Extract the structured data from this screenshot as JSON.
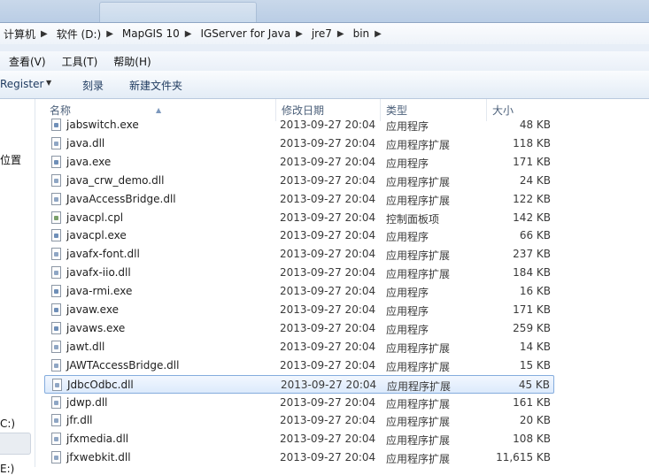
{
  "address_bar": {
    "crumbs": [
      "计算机",
      "软件 (D:)",
      "MapGIS 10",
      "IGServer for Java",
      "jre7",
      "bin"
    ],
    "separator": "▶"
  },
  "menu": [
    "查看(V)",
    "工具(T)",
    "帮助(H)"
  ],
  "toolbar": {
    "register": "Register",
    "burn": "刻录",
    "new_folder": "新建文件夹"
  },
  "nav": {
    "location_label": "位置",
    "drive_c": "C:)",
    "drive_e": "E:)"
  },
  "columns": {
    "name": "名称",
    "date": "修改日期",
    "type": "类型",
    "size": "大小"
  },
  "files": [
    {
      "name": "jabswitch.exe",
      "date": "2013-09-27 20:04",
      "type": "应用程序",
      "size": "48 KB",
      "icon": "exe-icon"
    },
    {
      "name": "java.dll",
      "date": "2013-09-27 20:04",
      "type": "应用程序扩展",
      "size": "118 KB",
      "icon": "dll-icon"
    },
    {
      "name": "java.exe",
      "date": "2013-09-27 20:04",
      "type": "应用程序",
      "size": "171 KB",
      "icon": "exe-icon"
    },
    {
      "name": "java_crw_demo.dll",
      "date": "2013-09-27 20:04",
      "type": "应用程序扩展",
      "size": "24 KB",
      "icon": "dll-icon"
    },
    {
      "name": "JavaAccessBridge.dll",
      "date": "2013-09-27 20:04",
      "type": "应用程序扩展",
      "size": "122 KB",
      "icon": "dll-icon"
    },
    {
      "name": "javacpl.cpl",
      "date": "2013-09-27 20:04",
      "type": "控制面板项",
      "size": "142 KB",
      "icon": "cpl-icon"
    },
    {
      "name": "javacpl.exe",
      "date": "2013-09-27 20:04",
      "type": "应用程序",
      "size": "66 KB",
      "icon": "exe-icon"
    },
    {
      "name": "javafx-font.dll",
      "date": "2013-09-27 20:04",
      "type": "应用程序扩展",
      "size": "237 KB",
      "icon": "dll-icon"
    },
    {
      "name": "javafx-iio.dll",
      "date": "2013-09-27 20:04",
      "type": "应用程序扩展",
      "size": "184 KB",
      "icon": "dll-icon"
    },
    {
      "name": "java-rmi.exe",
      "date": "2013-09-27 20:04",
      "type": "应用程序",
      "size": "16 KB",
      "icon": "exe-icon"
    },
    {
      "name": "javaw.exe",
      "date": "2013-09-27 20:04",
      "type": "应用程序",
      "size": "171 KB",
      "icon": "exe-icon"
    },
    {
      "name": "javaws.exe",
      "date": "2013-09-27 20:04",
      "type": "应用程序",
      "size": "259 KB",
      "icon": "exe-icon"
    },
    {
      "name": "jawt.dll",
      "date": "2013-09-27 20:04",
      "type": "应用程序扩展",
      "size": "14 KB",
      "icon": "dll-icon"
    },
    {
      "name": "JAWTAccessBridge.dll",
      "date": "2013-09-27 20:04",
      "type": "应用程序扩展",
      "size": "15 KB",
      "icon": "dll-icon"
    },
    {
      "name": "JdbcOdbc.dll",
      "date": "2013-09-27 20:04",
      "type": "应用程序扩展",
      "size": "45 KB",
      "icon": "dll-icon",
      "selected": true
    },
    {
      "name": "jdwp.dll",
      "date": "2013-09-27 20:04",
      "type": "应用程序扩展",
      "size": "161 KB",
      "icon": "dll-icon"
    },
    {
      "name": "jfr.dll",
      "date": "2013-09-27 20:04",
      "type": "应用程序扩展",
      "size": "20 KB",
      "icon": "dll-icon"
    },
    {
      "name": "jfxmedia.dll",
      "date": "2013-09-27 20:04",
      "type": "应用程序扩展",
      "size": "108 KB",
      "icon": "dll-icon"
    },
    {
      "name": "jfxwebkit.dll",
      "date": "2013-09-27 20:04",
      "type": "应用程序扩展",
      "size": "11,615 KB",
      "icon": "dll-icon"
    }
  ]
}
